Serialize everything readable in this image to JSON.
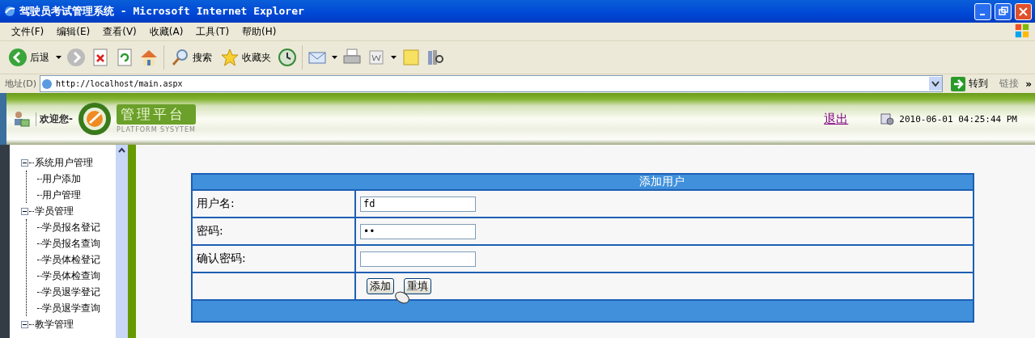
{
  "window": {
    "title": "驾驶员考试管理系统 - Microsoft Internet Explorer"
  },
  "menu": [
    "文件(F)",
    "编辑(E)",
    "查看(V)",
    "收藏(A)",
    "工具(T)",
    "帮助(H)"
  ],
  "toolbar": {
    "back": "后退",
    "search": "搜索",
    "favorites": "收藏夹"
  },
  "address": {
    "label": "地址(D)",
    "url": "http://localhost/main.aspx",
    "go": "转到",
    "links": "链接",
    "more": "»"
  },
  "header": {
    "welcome": "欢迎您-",
    "logo_title": "管理平台",
    "logo_subtitle": "PLATFORM SYSYTEM",
    "logout": "退出",
    "datetime": "2010-06-01 04:25:44 PM"
  },
  "tree": [
    {
      "label": "系统用户管理",
      "expanded": true,
      "children": [
        {
          "label": "用户添加"
        },
        {
          "label": "用户管理"
        }
      ]
    },
    {
      "label": "学员管理",
      "expanded": true,
      "children": [
        {
          "label": "学员报名登记"
        },
        {
          "label": "学员报名查询"
        },
        {
          "label": "学员体检登记"
        },
        {
          "label": "学员体检查询"
        },
        {
          "label": "学员退学登记"
        },
        {
          "label": "学员退学查询"
        }
      ]
    },
    {
      "label": "教学管理",
      "expanded": true
    }
  ],
  "form": {
    "title": "添加用户",
    "fields": [
      {
        "label": "用户名:",
        "value": "fd"
      },
      {
        "label": "密码:",
        "value": "••"
      },
      {
        "label": "确认密码:"
      }
    ],
    "buttons": [
      "添加",
      "重填"
    ]
  }
}
